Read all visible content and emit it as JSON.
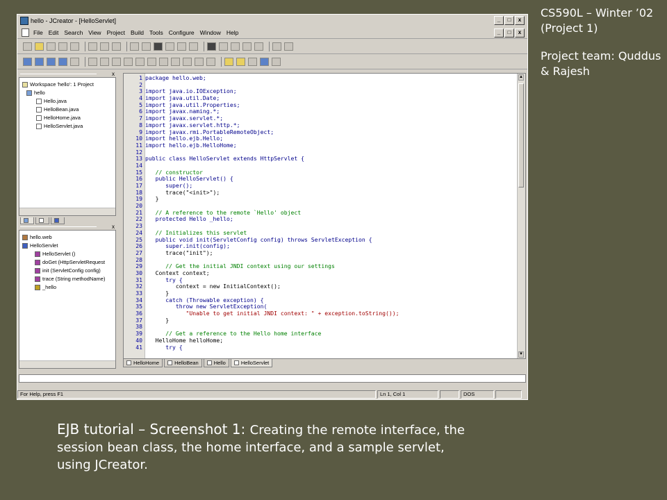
{
  "slide": {
    "side_title": "CS590L – Winter ’02 (Project 1)",
    "team": "Project team: Quddus & Rajesh",
    "caption_lead": "EJB tutorial – Screenshot 1: ",
    "caption_rest": "Creating the remote interface, the session bean class, the home interface, and a sample servlet, using JCreator."
  },
  "window": {
    "title": "hello - JCreator - [HelloServlet]",
    "controls": {
      "minimize": "_",
      "maximize": "□",
      "close": "x"
    }
  },
  "menu": [
    "File",
    "Edit",
    "Search",
    "View",
    "Project",
    "Build",
    "Tools",
    "Configure",
    "Window",
    "Help"
  ],
  "workspace": {
    "root": "Workspace 'hello': 1 Project",
    "project": "hello",
    "files": [
      "Hello.java",
      "HelloBean.java",
      "HelloHome.java",
      "HelloServlet.java"
    ]
  },
  "classview": {
    "package": "hello.web",
    "class": "HelloServlet",
    "members": [
      {
        "label": "HelloServlet ()",
        "kind": "method"
      },
      {
        "label": "doGet (HttpServletRequest",
        "kind": "method"
      },
      {
        "label": "init (ServletConfig config)",
        "kind": "method"
      },
      {
        "label": "trace (String methodName)",
        "kind": "method"
      },
      {
        "label": "_hello",
        "kind": "field"
      }
    ]
  },
  "editor": {
    "lines": [
      {
        "n": "1",
        "t": "package hello.web;",
        "k": "kw"
      },
      {
        "n": "2",
        "t": "",
        "k": ""
      },
      {
        "n": "3",
        "t": "import java.io.IOException;",
        "k": "kw"
      },
      {
        "n": "4",
        "t": "import java.util.Date;",
        "k": "kw"
      },
      {
        "n": "5",
        "t": "import java.util.Properties;",
        "k": "kw"
      },
      {
        "n": "6",
        "t": "import javax.naming.*;",
        "k": "kw"
      },
      {
        "n": "7",
        "t": "import javax.servlet.*;",
        "k": "kw"
      },
      {
        "n": "8",
        "t": "import javax.servlet.http.*;",
        "k": "kw"
      },
      {
        "n": "9",
        "t": "import javax.rmi.PortableRemoteObject;",
        "k": "kw"
      },
      {
        "n": "10",
        "t": "import hello.ejb.Hello;",
        "k": "kw"
      },
      {
        "n": "11",
        "t": "import hello.ejb.HelloHome;",
        "k": "kw"
      },
      {
        "n": "12",
        "t": "",
        "k": ""
      },
      {
        "n": "13",
        "t": "public class HelloServlet extends HttpServlet {",
        "k": "kw"
      },
      {
        "n": "14",
        "t": "",
        "k": ""
      },
      {
        "n": "15",
        "t": "   // constructor",
        "k": "cm"
      },
      {
        "n": "16",
        "t": "   public HelloServlet() {",
        "k": "kw"
      },
      {
        "n": "17",
        "t": "      super();",
        "k": "kw"
      },
      {
        "n": "18",
        "t": "      trace(\"<init>\");",
        "k": ""
      },
      {
        "n": "19",
        "t": "   }",
        "k": ""
      },
      {
        "n": "20",
        "t": "",
        "k": ""
      },
      {
        "n": "21",
        "t": "   // A reference to the remote `Hello' object",
        "k": "cm"
      },
      {
        "n": "22",
        "t": "   protected Hello _hello;",
        "k": "kw"
      },
      {
        "n": "23",
        "t": "",
        "k": ""
      },
      {
        "n": "24",
        "t": "   // Initializes this servlet",
        "k": "cm"
      },
      {
        "n": "25",
        "t": "   public void init(ServletConfig config) throws ServletException {",
        "k": "kw"
      },
      {
        "n": "26",
        "t": "      super.init(config);",
        "k": "kw"
      },
      {
        "n": "27",
        "t": "      trace(\"init\");",
        "k": ""
      },
      {
        "n": "28",
        "t": "",
        "k": ""
      },
      {
        "n": "29",
        "t": "      // Get the initial JNDI context using our settings",
        "k": "cm"
      },
      {
        "n": "30",
        "t": "   Context context;",
        "k": ""
      },
      {
        "n": "31",
        "t": "      try {",
        "k": "kw"
      },
      {
        "n": "32",
        "t": "         context = new InitialContext();",
        "k": ""
      },
      {
        "n": "33",
        "t": "      }",
        "k": ""
      },
      {
        "n": "34",
        "t": "      catch (Throwable exception) {",
        "k": "kw"
      },
      {
        "n": "35",
        "t": "         throw new ServletException(",
        "k": "kw"
      },
      {
        "n": "36",
        "t": "            \"Unable to get initial JNDI context: \" + exception.toString());",
        "k": "st"
      },
      {
        "n": "37",
        "t": "      }",
        "k": ""
      },
      {
        "n": "38",
        "t": "",
        "k": ""
      },
      {
        "n": "39",
        "t": "      // Get a reference to the Hello home interface",
        "k": "cm"
      },
      {
        "n": "40",
        "t": "   HelloHome helloHome;",
        "k": ""
      },
      {
        "n": "41",
        "t": "      try {",
        "k": "kw"
      }
    ]
  },
  "tabs": {
    "workspace": [
      "",
      "",
      "",
      "",
      ""
    ],
    "editor": [
      "HelloHome",
      "HelloBean",
      "Hello",
      "HelloServlet"
    ]
  },
  "status": {
    "help": "For Help, press F1",
    "position": "Ln 1, Col 1",
    "mode": "DOS"
  }
}
